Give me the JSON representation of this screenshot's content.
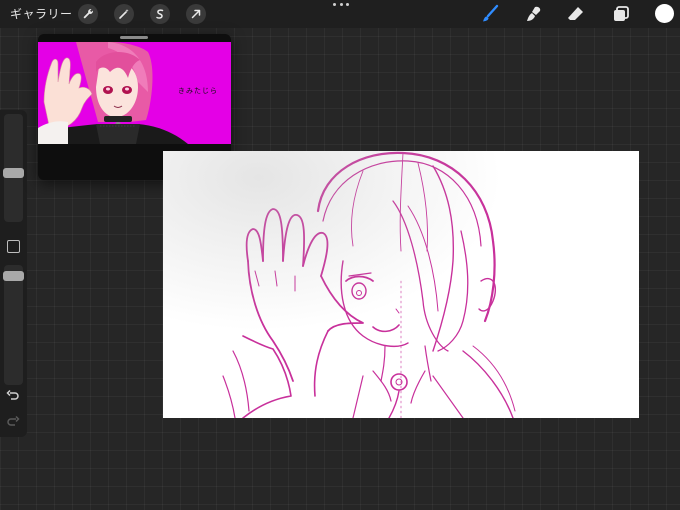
{
  "toolbar": {
    "gallery_label": "ギャラリー",
    "left_tools": [
      "wrench-icon",
      "magic-wand-icon",
      "selection-icon",
      "transform-arrow-icon"
    ],
    "right_tools": [
      "brush-icon",
      "smudge-icon",
      "eraser-icon",
      "layers-icon"
    ],
    "active_tool": "brush-icon",
    "active_color": "#2f8cff",
    "current_color": "#ffffff"
  },
  "sidebar": {
    "brush_size_level": 0.55,
    "opacity_level": 0.95
  },
  "reference": {
    "caption": "きみたじら",
    "background_color": "#e400e6"
  },
  "canvas": {
    "sketch_color": "#c8309b"
  }
}
